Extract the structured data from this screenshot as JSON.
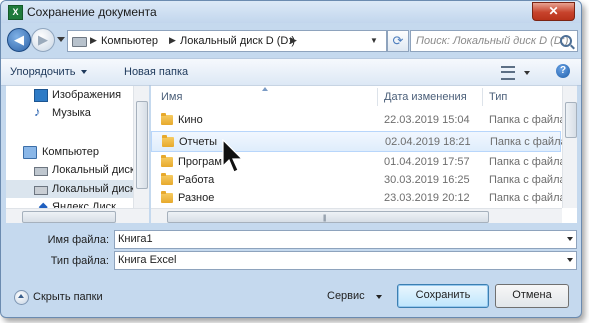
{
  "window": {
    "title": "Сохранение документа",
    "app_icon_glyph": "X",
    "close_glyph": "✕"
  },
  "navbar": {
    "back_glyph": "◀",
    "forward_glyph": "▶",
    "breadcrumb": [
      "Компьютер",
      "Локальный диск D (D:)"
    ],
    "refresh_glyph": "⟳",
    "search_placeholder": "Поиск: Локальный диск D (D:)"
  },
  "toolbar": {
    "organize_label": "Упорядочить",
    "new_folder_label": "Новая папка",
    "help_glyph": "?"
  },
  "sidebar": {
    "items": [
      {
        "label": "Изображения",
        "icon": "pictures-icon"
      },
      {
        "label": "Музыка",
        "icon": "music-icon"
      },
      {
        "label": "Компьютер",
        "icon": "computer-icon"
      },
      {
        "label": "Локальный диск",
        "icon": "drive-icon"
      },
      {
        "label": "Локальный диск",
        "icon": "drive-icon",
        "selected": true
      },
      {
        "label": "Яндекс.Диск",
        "icon": "yandex-disk-icon"
      }
    ]
  },
  "files": {
    "columns": [
      "Имя",
      "Дата изменения",
      "Тип"
    ],
    "rows": [
      {
        "name": "Кино",
        "date": "22.03.2019 15:04",
        "type": "Папка с файлами"
      },
      {
        "name": "Отчеты",
        "date": "02.04.2019 18:21",
        "type": "Папка с файлами",
        "selected": true
      },
      {
        "name": "Програм",
        "date": "01.04.2019 17:57",
        "type": "Папка с файлами"
      },
      {
        "name": "Работа",
        "date": "30.03.2019 16:25",
        "type": "Папка с файлами"
      },
      {
        "name": "Разное",
        "date": "23.03.2019 20:12",
        "type": "Папка с файлами"
      }
    ]
  },
  "form": {
    "filename_label": "Имя файла:",
    "filename_value": "Книга1",
    "filetype_label": "Тип файла:",
    "filetype_value": "Книга Excel"
  },
  "footer": {
    "hide_folders_label": "Скрыть папки",
    "service_label": "Сервис",
    "save_label": "Сохранить",
    "cancel_label": "Отмена"
  }
}
